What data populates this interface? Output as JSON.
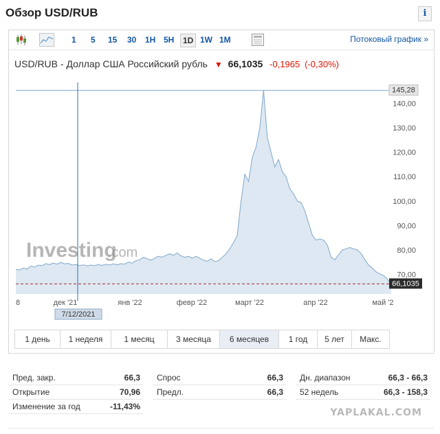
{
  "header": {
    "title": "Обзор USD/RUB",
    "info_label": "i"
  },
  "toolbar": {
    "intervals": [
      "1",
      "5",
      "15",
      "30",
      "1H",
      "5H",
      "1D",
      "1W",
      "1M"
    ],
    "active_interval": "1D",
    "stream_link": "Потоковый график »"
  },
  "quote": {
    "name": "USD/RUB - Доллар США Российский рубль",
    "price": "66,1035",
    "change": "-0,1965",
    "change_pct": "(-0,30%)"
  },
  "chart_data": {
    "type": "area",
    "x_labels": [
      "8",
      "дек '21",
      "янв '22",
      "февр '22",
      "март '22",
      "апр '22",
      "май '2"
    ],
    "y_ticks": [
      "70,00",
      "80,00",
      "90,00",
      "100,00",
      "110,00",
      "120,00",
      "130,00",
      "140,00"
    ],
    "y_tick_values": [
      70,
      80,
      90,
      100,
      110,
      120,
      130,
      140
    ],
    "ylim": [
      62,
      148
    ],
    "high_label": "145,28",
    "last_label": "66,1035",
    "last_value": 66.1035,
    "high_value": 145.28,
    "crosshair_date": "7/12/2021",
    "watermark_text": "Investing",
    "watermark_suffix": ".com",
    "grid": false,
    "colors": {
      "line": "#7fa7c9",
      "fill": "#dde8f2",
      "last_line": "#a52a2a",
      "crosshair": "#2f6fb0"
    },
    "series": [
      {
        "values": [
          72.0,
          71.8,
          72.6,
          72.2,
          73.4,
          73.0,
          73.8,
          73.6,
          74.4,
          74.0,
          74.6,
          74.2,
          74.9,
          74.3,
          74.5,
          73.8,
          74.0,
          73.6,
          73.9,
          73.5,
          73.8,
          73.6,
          74.0,
          73.7,
          74.1,
          73.8,
          74.3,
          73.9,
          74.4,
          74.2,
          75.0,
          74.6,
          75.6,
          76.0,
          77.0,
          76.4,
          75.8,
          76.6,
          77.4,
          77.0,
          77.8,
          78.4,
          77.8,
          78.8,
          77.6,
          77.0,
          77.4,
          76.6,
          77.4,
          76.6,
          75.8,
          75.4,
          76.4,
          75.2,
          75.6,
          77.0,
          78.4,
          80.5,
          83.0,
          86.0,
          100.0,
          111.0,
          108.0,
          118.0,
          122.0,
          130.0,
          145.28,
          126.0,
          120.0,
          114.0,
          117.0,
          112.0,
          110.0,
          105.0,
          103.0,
          100.0,
          99.5,
          96.0,
          91.0,
          86.0,
          84.0,
          84.5,
          84.0,
          82.0,
          77.0,
          76.0,
          78.0,
          80.0,
          80.5,
          81.0,
          80.4,
          80.0,
          78.5,
          76.0,
          73.8,
          72.5,
          71.0,
          70.2,
          69.5,
          68.0,
          66.1035
        ]
      }
    ]
  },
  "ranges": {
    "items": [
      "1 день",
      "1 неделя",
      "1 месяц",
      "3 месяца",
      "6 месяцев",
      "1 год",
      "5 лет",
      "Макс."
    ],
    "active": "6 месяцев"
  },
  "stats": {
    "col1": [
      {
        "label": "Пред. закр.",
        "value": "66,3"
      },
      {
        "label": "Открытие",
        "value": "70,96"
      },
      {
        "label": "Изменение за год",
        "value": "-11,43%"
      }
    ],
    "col2": [
      {
        "label": "Спрос",
        "value": "66,3"
      },
      {
        "label": "Предл.",
        "value": "66,3"
      }
    ],
    "col3": [
      {
        "label": "Дн. диапазон",
        "value": "66,3 - 66,3"
      },
      {
        "label": "52 недель",
        "value": "66,3 - 158,3"
      }
    ]
  },
  "footer": {
    "watermark": "YAPLAKAL.COM"
  }
}
